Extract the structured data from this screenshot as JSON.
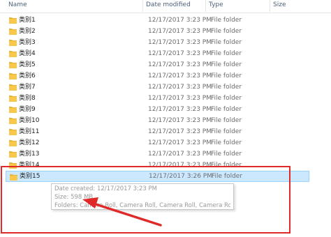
{
  "columns": {
    "name": "Name",
    "date_modified": "Date modified",
    "type": "Type",
    "size": "Size"
  },
  "rows": [
    {
      "name": "类别1",
      "date": "12/17/2017 3:23 PM",
      "type": "File folder"
    },
    {
      "name": "类别2",
      "date": "12/17/2017 3:23 PM",
      "type": "File folder"
    },
    {
      "name": "类别3",
      "date": "12/17/2017 3:23 PM",
      "type": "File folder"
    },
    {
      "name": "类别4",
      "date": "12/17/2017 3:23 PM",
      "type": "File folder"
    },
    {
      "name": "类别5",
      "date": "12/17/2017 3:23 PM",
      "type": "File folder"
    },
    {
      "name": "类别6",
      "date": "12/17/2017 3:23 PM",
      "type": "File folder"
    },
    {
      "name": "类别7",
      "date": "12/17/2017 3:23 PM",
      "type": "File folder"
    },
    {
      "name": "类别8",
      "date": "12/17/2017 3:23 PM",
      "type": "File folder"
    },
    {
      "name": "类别9",
      "date": "12/17/2017 3:23 PM",
      "type": "File folder"
    },
    {
      "name": "类别10",
      "date": "12/17/2017 3:23 PM",
      "type": "File folder"
    },
    {
      "name": "类别11",
      "date": "12/17/2017 3:23 PM",
      "type": "File folder"
    },
    {
      "name": "类别12",
      "date": "12/17/2017 3:23 PM",
      "type": "File folder"
    },
    {
      "name": "类别13",
      "date": "12/17/2017 3:23 PM",
      "type": "File folder"
    },
    {
      "name": "类别14",
      "date": "12/17/2017 3:23 PM",
      "type": "File folder"
    },
    {
      "name": "类别15",
      "date": "12/17/2017 3:26 PM",
      "type": "File folder"
    }
  ],
  "selected_row_index": 14,
  "tooltip": {
    "date_created": "Date created: 12/17/2017 3:23 PM",
    "size": "Size: 598 MB",
    "folders": "Folders: Camera Roll, Camera Roll, Camera Roll, Camera Roll, Camera Roll, ..."
  },
  "colors": {
    "folder": "#f8c84a",
    "selection": "#cce8ff",
    "annotation": "#e02a2a"
  },
  "icons": {
    "folder": "folder-icon"
  }
}
